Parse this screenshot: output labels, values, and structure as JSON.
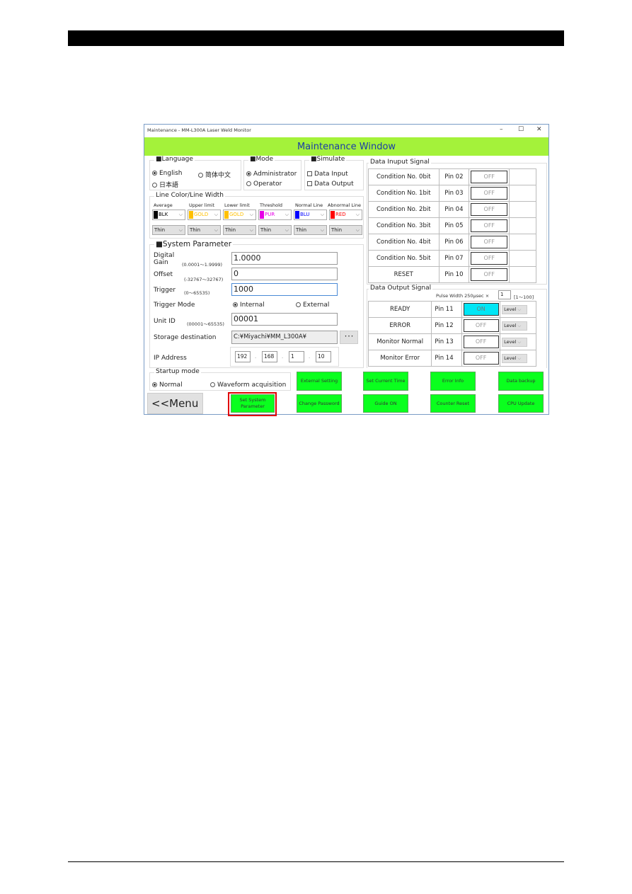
{
  "window": {
    "title": "Maintenance - MM-L300A Laser Weld Monitor",
    "header": "Maintenance Window",
    "min": "–",
    "max": "☐",
    "close": "✕"
  },
  "language": {
    "title": "■Language",
    "options": [
      "English",
      "简体中文",
      "日本語"
    ],
    "selected": "English"
  },
  "mode": {
    "title": "■Mode",
    "options": [
      "Administrator",
      "Operator"
    ],
    "selected": "Administrator"
  },
  "simulate": {
    "title": "■Simulate",
    "options": [
      "Data Input",
      "Data Output"
    ]
  },
  "line_color": {
    "title": "Line Color/Line Width",
    "columns": [
      {
        "label": "Average",
        "color": "BLK",
        "hex": "#000000",
        "width": "Thin"
      },
      {
        "label": "Upper limit",
        "color": "GOLD",
        "hex": "#ffc000",
        "width": "Thin"
      },
      {
        "label": "Lower limit",
        "color": "GOLD",
        "hex": "#ffc000",
        "width": "Thin"
      },
      {
        "label": "Threshold",
        "color": "PUR",
        "hex": "#e600e6",
        "width": "Thin"
      },
      {
        "label": "Normal Line",
        "color": "BLU",
        "hex": "#0000ff",
        "width": "Thin"
      },
      {
        "label": "Abnormal Line",
        "color": "RED",
        "hex": "#ff0000",
        "width": "Thin"
      }
    ]
  },
  "system": {
    "title": "■System Parameter",
    "digital_gain": {
      "label1": "Digital",
      "label2": "Gain",
      "range": "(0.0001～1.9999)",
      "value": "1.0000"
    },
    "offset": {
      "label": "Offset",
      "range": "(-32767～32767)",
      "value": "0"
    },
    "trigger": {
      "label": "Trigger",
      "range": "(0～65535)",
      "value": "1000"
    },
    "trigger_mode": {
      "label": "Trigger Mode",
      "options": [
        "Internal",
        "External"
      ],
      "selected": "Internal"
    },
    "unit_id": {
      "label": "Unit ID",
      "range": "(00001～65535)",
      "value": "00001"
    },
    "storage": {
      "label": "Storage destination",
      "value": "C:¥Miyachi¥MM_L300A¥",
      "browse": "･･･"
    },
    "ip": {
      "label": "IP Address",
      "octets": [
        "192",
        "168",
        "1",
        "10"
      ],
      "sep": "."
    }
  },
  "startup": {
    "title": "Startup mode",
    "options": [
      "Normal",
      "Waveform acquisition"
    ],
    "selected": "Normal"
  },
  "menu_button": "<<Menu",
  "buttons": {
    "set_system": "Set System Parameter",
    "external": "External Setting",
    "change_pw": "Change Password",
    "set_time": "Set Current Time",
    "guide": "Guide ON",
    "error_info": "Error Info",
    "counter_reset": "Counter Reset",
    "backup": "Data backup",
    "cpu_update": "CPU Update"
  },
  "input_signal": {
    "title": "Data Inuput Signal",
    "rows": [
      {
        "name": "Condition No. 0bit",
        "pin": "Pin 02",
        "state": "OFF"
      },
      {
        "name": "Condition No. 1bit",
        "pin": "Pin 03",
        "state": "OFF"
      },
      {
        "name": "Condition No. 2bit",
        "pin": "Pin 04",
        "state": "OFF"
      },
      {
        "name": "Condition No. 3bit",
        "pin": "Pin 05",
        "state": "OFF"
      },
      {
        "name": "Condition No. 4bit",
        "pin": "Pin 06",
        "state": "OFF"
      },
      {
        "name": "Condition No. 5bit",
        "pin": "Pin 07",
        "state": "OFF"
      },
      {
        "name": "RESET",
        "pin": "Pin 10",
        "state": "OFF"
      }
    ]
  },
  "output_signal": {
    "title": "Data Output Signal",
    "pulse_label": "Pulse Width  250μsec ×",
    "pulse_value": "1",
    "pulse_range": "[1～100]",
    "rows": [
      {
        "name": "READY",
        "pin": "Pin 11",
        "state": "ON",
        "mode": "Level"
      },
      {
        "name": "ERROR",
        "pin": "Pin 12",
        "state": "OFF",
        "mode": "Level"
      },
      {
        "name": "Monitor Normal",
        "pin": "Pin 13",
        "state": "OFF",
        "mode": "Level"
      },
      {
        "name": "Monitor Error",
        "pin": "Pin 14",
        "state": "OFF",
        "mode": "Level"
      }
    ]
  },
  "colors": {
    "header": "#a4f23a",
    "button": "#0aff1e",
    "on": "#00e6f5",
    "highlight": "#e00000"
  }
}
